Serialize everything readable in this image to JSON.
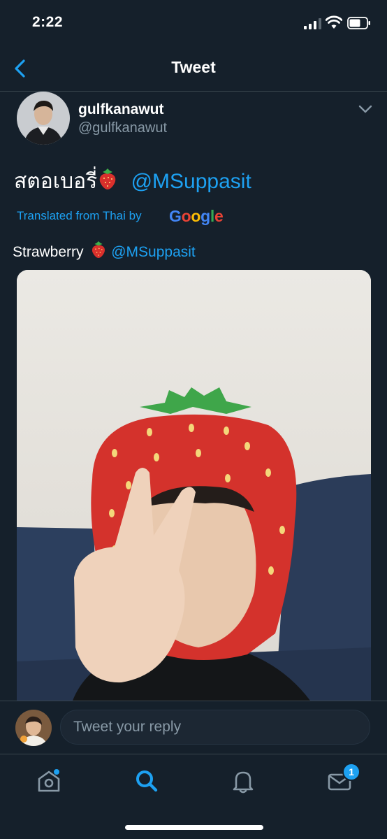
{
  "status_bar": {
    "time": "2:22"
  },
  "header": {
    "title": "Tweet",
    "back_icon": "chevron-left-icon"
  },
  "tweet": {
    "display_name": "gulfkanawut",
    "handle": "@gulfkanawut",
    "text_thai": "สตอเบอรี่",
    "mention": "@MSuppasit",
    "translated_label": "Translated from Thai by",
    "translator_logo": [
      "G",
      "o",
      "o",
      "g",
      "l",
      "e"
    ],
    "translation_text": "Strawberry",
    "translation_mention": "@MSuppasit",
    "emoji_icon": "strawberry-icon"
  },
  "reply": {
    "placeholder": "Tweet your reply"
  },
  "tab_bar": {
    "items": [
      "home-icon",
      "search-icon",
      "bell-icon",
      "mail-icon"
    ],
    "messages_badge": "1"
  },
  "colors": {
    "background": "#15202b",
    "accent": "#1da1f2",
    "secondary_text": "#8899a6",
    "divider": "#38444d"
  }
}
